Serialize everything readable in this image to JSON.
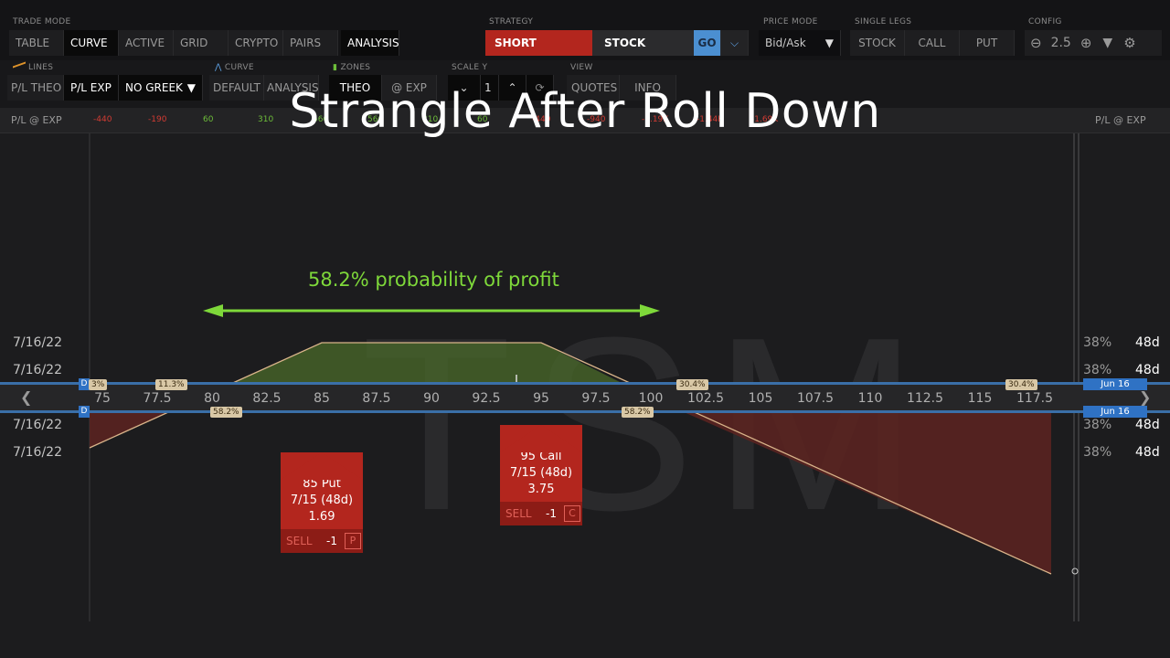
{
  "header": {
    "trade_mode": {
      "label": "TRADE MODE",
      "tabs": [
        "TABLE",
        "CURVE",
        "ACTIVE",
        "GRID",
        "CRYPTO",
        "PAIRS",
        "ANALYSIS"
      ],
      "selected": "CURVE"
    },
    "strategy": {
      "label": "STRATEGY",
      "side": "SHORT",
      "type": "STOCK",
      "go": "GO"
    },
    "price_mode": {
      "label": "PRICE MODE",
      "value": "Bid/Ask"
    },
    "single_legs": {
      "label": "SINGLE LEGS",
      "items": [
        "STOCK",
        "CALL",
        "PUT"
      ]
    },
    "config": {
      "label": "CONFIG",
      "zoom": "2.5"
    }
  },
  "subheader": {
    "lines": {
      "label": "LINES",
      "items": [
        "P/L THEO",
        "P/L EXP"
      ],
      "greek": "NO GREEK"
    },
    "curve": {
      "label": "CURVE",
      "items": [
        "DEFAULT",
        "ANALYSIS"
      ]
    },
    "zones": {
      "label": "ZONES",
      "items": [
        "THEO",
        "@ EXP"
      ]
    },
    "scale_y": {
      "label": "SCALE Y",
      "value": "1"
    },
    "view": {
      "label": "VIEW",
      "items": [
        "QUOTES",
        "INFO"
      ]
    }
  },
  "pl_row": {
    "label": "P/L @ EXP",
    "label_right": "P/L @ EXP",
    "values": [
      "-440",
      "-190",
      "60",
      "310",
      "560",
      "560",
      "310",
      "60",
      "-440",
      "-940",
      "-1.19K",
      "-1.44K",
      "-1.69K"
    ]
  },
  "overlay": {
    "title": "Strangle After Roll Down",
    "probability": "58.2% probability of profit",
    "watermark": "TSM"
  },
  "dates": {
    "left": [
      "7/16/22",
      "7/16/22",
      "7/16/22",
      "7/16/22"
    ],
    "right_pct": [
      "38%",
      "38%",
      "38%",
      "38%"
    ],
    "right_days": [
      "48d",
      "48d",
      "48d",
      "48d"
    ]
  },
  "axis": {
    "strikes": [
      "75",
      "77.5",
      "80",
      "82.5",
      "85",
      "87.5",
      "90",
      "92.5",
      "95",
      "97.5",
      "100",
      "102.5",
      "105",
      "107.5",
      "110",
      "112.5",
      "115",
      "117.5"
    ],
    "pct_top": [
      "3%",
      "11.3%",
      "30.4%",
      "30.4%"
    ],
    "pct_bottom": [
      "58.2%",
      "58.2%"
    ],
    "d_badge": "D",
    "exp_label": "Jun 16"
  },
  "legs": [
    {
      "strike": "85 Put",
      "expiry": "7/15 (48d)",
      "price": "1.69",
      "action": "SELL",
      "qty": "-1",
      "type": "P"
    },
    {
      "strike": "95 Call",
      "expiry": "7/15 (48d)",
      "price": "3.75",
      "action": "SELL",
      "qty": "-1",
      "type": "C"
    }
  ],
  "colors": {
    "profit_zone": "#4a6a2a",
    "loss_zone": "#5a2420",
    "arrow": "#7ed83a",
    "accent_blue": "#2f72c4",
    "short_red": "#b3261e"
  }
}
